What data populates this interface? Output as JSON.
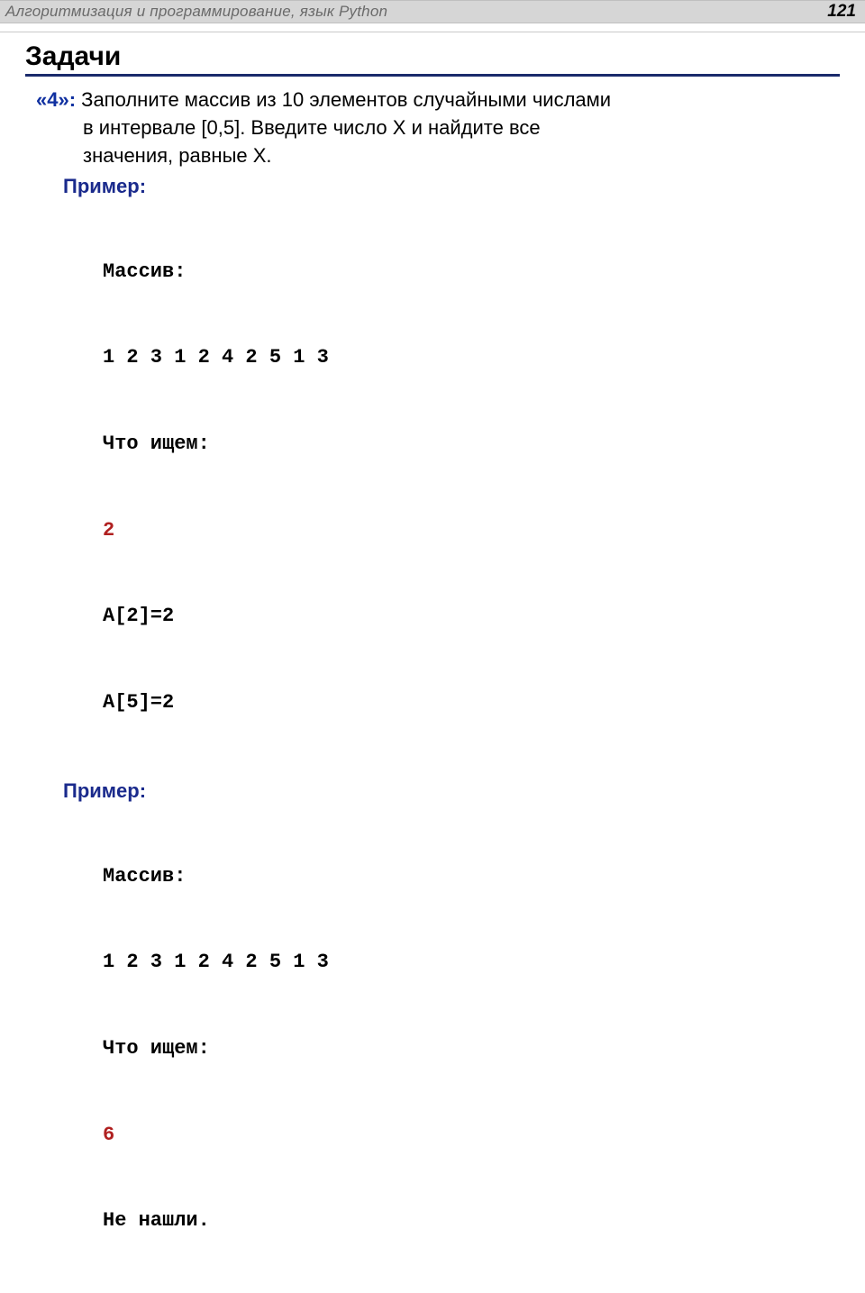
{
  "top": {
    "title": "Алгоритмизация и программирование, язык Python",
    "page": "121"
  },
  "heading": "Задачи",
  "task": {
    "grade": "«4»:",
    "line1": " Заполните массив из 10 элементов случайными числами",
    "line2": "в интервале [0,5]. Введите число X и найдите все",
    "line3": "значения, равные X."
  },
  "ex1": {
    "label": "Пример:",
    "l1": "Массив:",
    "l2": "1 2 3 1 2 4 2 5 1 3",
    "l3": "Что ищем:",
    "l4": "2",
    "l5": "A[2]=2",
    "l6": "A[5]=2"
  },
  "ex2": {
    "label": "Пример:",
    "l1": "Массив:",
    "l2": "1 2 3 1 2 4 2 5 1 3",
    "l3": "Что ищем:",
    "l4": "6",
    "l5": "Не нашли."
  }
}
